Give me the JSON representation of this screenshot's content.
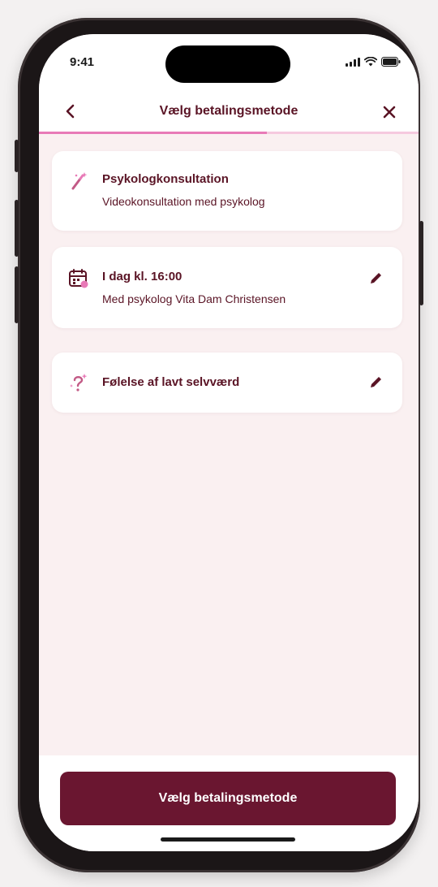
{
  "status_bar": {
    "time": "9:41"
  },
  "header": {
    "back_icon": "chevron-left-icon",
    "title": "Vælg betalingsmetode",
    "close_icon": "close-icon"
  },
  "progress": {
    "value": 0.6,
    "track_color": "#f6c9df",
    "fill_color": "#e87ab7"
  },
  "summary_cards": [
    {
      "icon": "magic-wand-icon",
      "title": "Psykologkonsultation",
      "subtitle": "Videokonsultation med psykolog",
      "editable": false
    },
    {
      "icon": "calendar-icon",
      "title": "I dag kl. 16:00",
      "subtitle": "Med psykolog Vita Dam Christensen",
      "editable": true,
      "edit_icon": "pencil-icon"
    },
    {
      "icon": "sparkle-question-icon",
      "title": "Følelse af lavt selvværd",
      "editable": true,
      "edit_icon": "pencil-icon"
    }
  ],
  "footer": {
    "primary_button_label": "Vælg betalingsmetode"
  },
  "colors": {
    "brand": "#5a1425",
    "button": "#6a1630",
    "background": "#faf0f1",
    "accent_pink": "#e87ab7"
  }
}
